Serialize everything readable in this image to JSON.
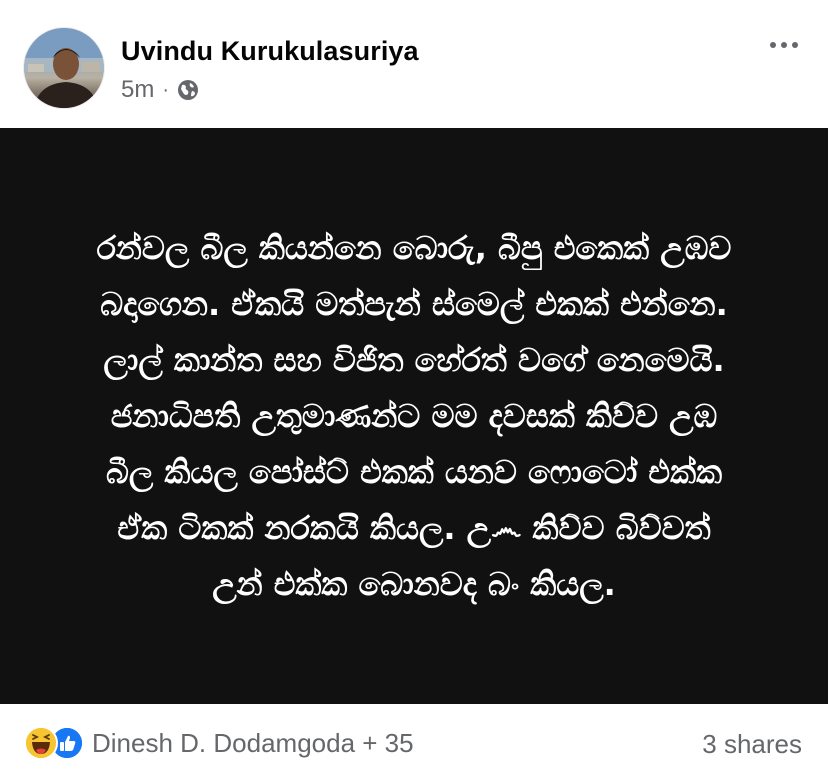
{
  "post": {
    "author": "Uvindu Kurukulasuriya",
    "time": "5m",
    "separator": "·",
    "privacy_icon": "globe-icon",
    "more_icon": "more-options-icon",
    "text": "රන්වල බීල කියන්නෙ බොරු, බීපු එකෙක් උඹව\nබදාගෙන. ඒකයි මත්පැන් ස්මෙල් එකක් එන්නෙ.\nලාල් කාන්ත සහ විජිත හේරත් වගේ නෙමෙයි.\nජනාධිපති උතුමාණන්ට මම දවසක් කිව්ව උඹ\nබීල කියල පෝස්ට් එකක් යනව ෆොටෝ එක්ක\nඒක ටිකක් නරකයි කියල. උ෴ කිව්ව බිව්වත්\nඋන් එක්ක බොනවද බං කියල.",
    "background_color": "#111111"
  },
  "footer": {
    "reaction_icons": [
      "haha-reaction-icon",
      "like-reaction-icon"
    ],
    "reactors": "Dinesh D. Dodamgoda + 35",
    "shares": "3 shares"
  }
}
